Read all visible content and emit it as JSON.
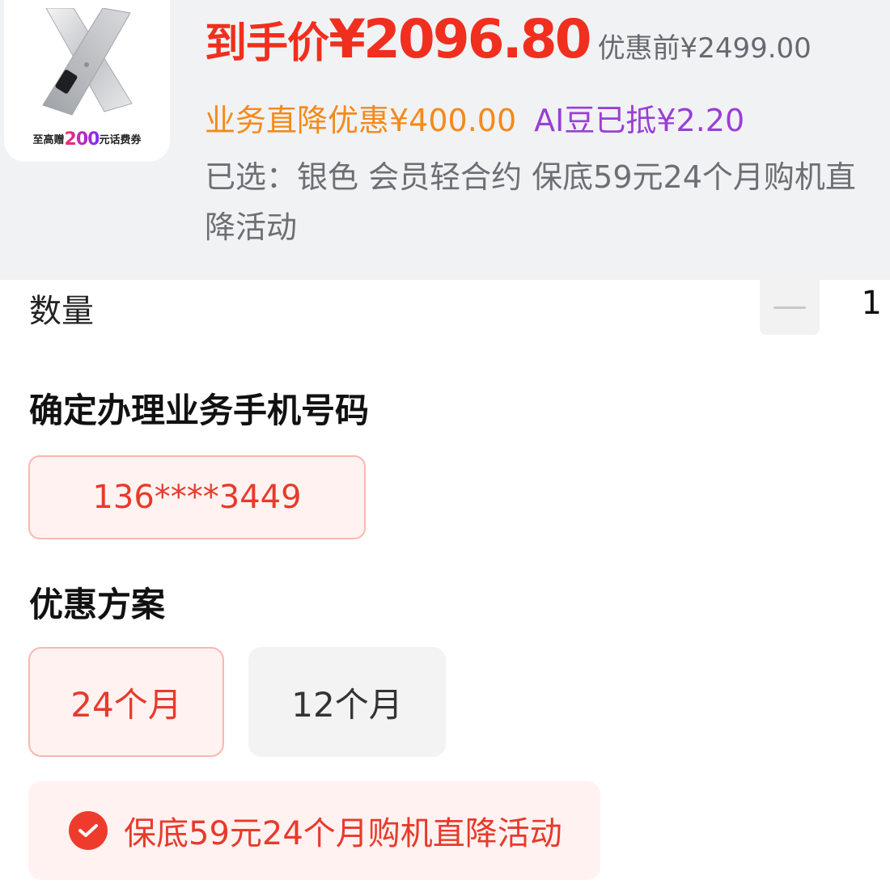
{
  "product": {
    "image_caption_prefix": "至高赠",
    "image_caption_number": "200",
    "image_caption_suffix": "元话费券"
  },
  "price": {
    "label": "到手价",
    "value": "¥2096.80",
    "original": "优惠前¥2499.00"
  },
  "discounts": {
    "business": "业务直降优惠¥400.00",
    "ai_beans": "AI豆已抵¥2.20"
  },
  "selected": {
    "text": "已选：银色  会员轻合约  保底59元24个月购机直降活动"
  },
  "quantity": {
    "label": "数量",
    "value": "1"
  },
  "phone_section": {
    "title": "确定办理业务手机号码",
    "number": "136****3449"
  },
  "plan_section": {
    "title": "优惠方案",
    "options": [
      {
        "label": "24个月",
        "selected": true
      },
      {
        "label": "12个月",
        "selected": false
      }
    ],
    "promo": "保底59元24个月购机直降活动"
  },
  "colors": {
    "price_red": "#f02f1e",
    "orange": "#f38a1b",
    "purple": "#9a3fd6",
    "chip_bg": "#fff2f1"
  }
}
